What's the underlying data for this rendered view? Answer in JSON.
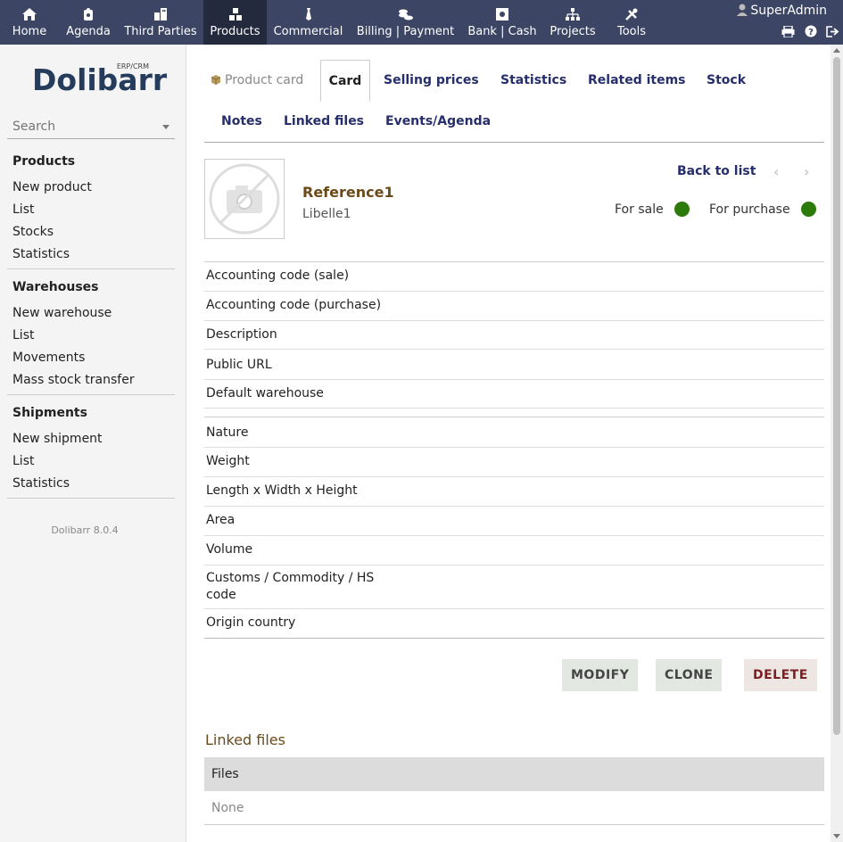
{
  "topnav": {
    "items": [
      {
        "label": "Home",
        "icon": "home-icon"
      },
      {
        "label": "Agenda",
        "icon": "agenda-icon"
      },
      {
        "label": "Third Parties",
        "icon": "building-icon"
      },
      {
        "label": "Products",
        "icon": "boxes-icon",
        "active": true
      },
      {
        "label": "Commercial",
        "icon": "tie-icon"
      },
      {
        "label": "Billing | Payment",
        "icon": "coins-icon"
      },
      {
        "label": "Bank | Cash",
        "icon": "safe-icon"
      },
      {
        "label": "Projects",
        "icon": "hierarchy-icon"
      },
      {
        "label": "Tools",
        "icon": "tools-icon"
      }
    ],
    "user": "SuperAdmin",
    "colors": {
      "bar": "#3c4664",
      "active": "#232a3e"
    }
  },
  "sidebar": {
    "logo_text": "Dolibarr",
    "logo_sup": "ERP/CRM",
    "search_placeholder": "Search",
    "blocks": [
      {
        "title": "Products",
        "items": [
          "New product",
          "List",
          "Stocks",
          "Statistics"
        ]
      },
      {
        "title": "Warehouses",
        "items": [
          "New warehouse",
          "List",
          "Movements",
          "Mass stock transfer"
        ]
      },
      {
        "title": "Shipments",
        "items": [
          "New shipment",
          "List",
          "Statistics"
        ]
      }
    ],
    "version": "Dolibarr 8.0.4"
  },
  "tabs": {
    "label": "Product card",
    "items": [
      "Card",
      "Selling prices",
      "Statistics",
      "Related items",
      "Stock",
      "Notes",
      "Linked files",
      "Events/Agenda"
    ],
    "active": "Card"
  },
  "product": {
    "ref": "Reference1",
    "label": "Libelle1",
    "back_to_list": "Back to list",
    "for_sale": "For sale",
    "for_purchase": "For purchase",
    "status_color": "#2b7a0b"
  },
  "fields": {
    "group1": [
      "Accounting code (sale)",
      "Accounting code (purchase)",
      "Description",
      "Public URL",
      "Default warehouse"
    ],
    "group2": [
      "Nature",
      "Weight",
      "Length x Width x Height",
      "Area",
      "Volume",
      "Customs / Commodity / HS code",
      "Origin country"
    ]
  },
  "actions": {
    "modify": "MODIFY",
    "clone": "CLONE",
    "delete": "DELETE"
  },
  "linked_files": {
    "title": "Linked files",
    "header": "Files",
    "empty": "None"
  }
}
